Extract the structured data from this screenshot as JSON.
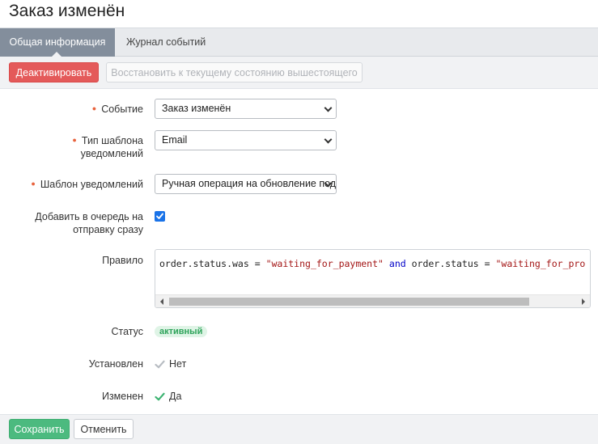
{
  "page": {
    "title": "Заказ изменён"
  },
  "tabs": [
    {
      "label": "Общая информация",
      "active": true
    },
    {
      "label": "Журнал событий",
      "active": false
    }
  ],
  "toolbar": {
    "deactivate_label": "Деактивировать",
    "restore_label": "Восстановить к текущему состоянию вышестоящего"
  },
  "form": {
    "event": {
      "label": "Событие",
      "value": "Заказ изменён",
      "required": true
    },
    "template_type": {
      "label": "Тип шаблона уведомлений",
      "value": "Email",
      "required": true
    },
    "template": {
      "label": "Шаблон уведомлений",
      "value": "Ручная операция на обновление подписки",
      "required": true
    },
    "queue_now": {
      "label": "Добавить в очередь на отправку сразу",
      "checked": true
    },
    "rule": {
      "label": "Правило",
      "tokens": [
        {
          "text": "order.status.was = ",
          "kind": "plain"
        },
        {
          "text": "\"waiting_for_payment\"",
          "kind": "str"
        },
        {
          "text": " ",
          "kind": "plain"
        },
        {
          "text": "and",
          "kind": "kw"
        },
        {
          "text": " order.status = ",
          "kind": "plain"
        },
        {
          "text": "\"waiting_for_pro",
          "kind": "str"
        }
      ]
    },
    "status": {
      "label": "Статус",
      "value": "активный",
      "color": "#2ea35a"
    },
    "installed": {
      "label": "Установлен",
      "value": "Нет",
      "icon": "check-icon-gray"
    },
    "modified": {
      "label": "Изменен",
      "value": "Да",
      "icon": "check-icon-green"
    }
  },
  "footer": {
    "save_label": "Сохранить",
    "cancel_label": "Отменить"
  },
  "colors": {
    "danger": "#e45a5a",
    "success": "#4cba7f",
    "tab_active": "#838e9c",
    "checkbox": "#1a73e8"
  }
}
